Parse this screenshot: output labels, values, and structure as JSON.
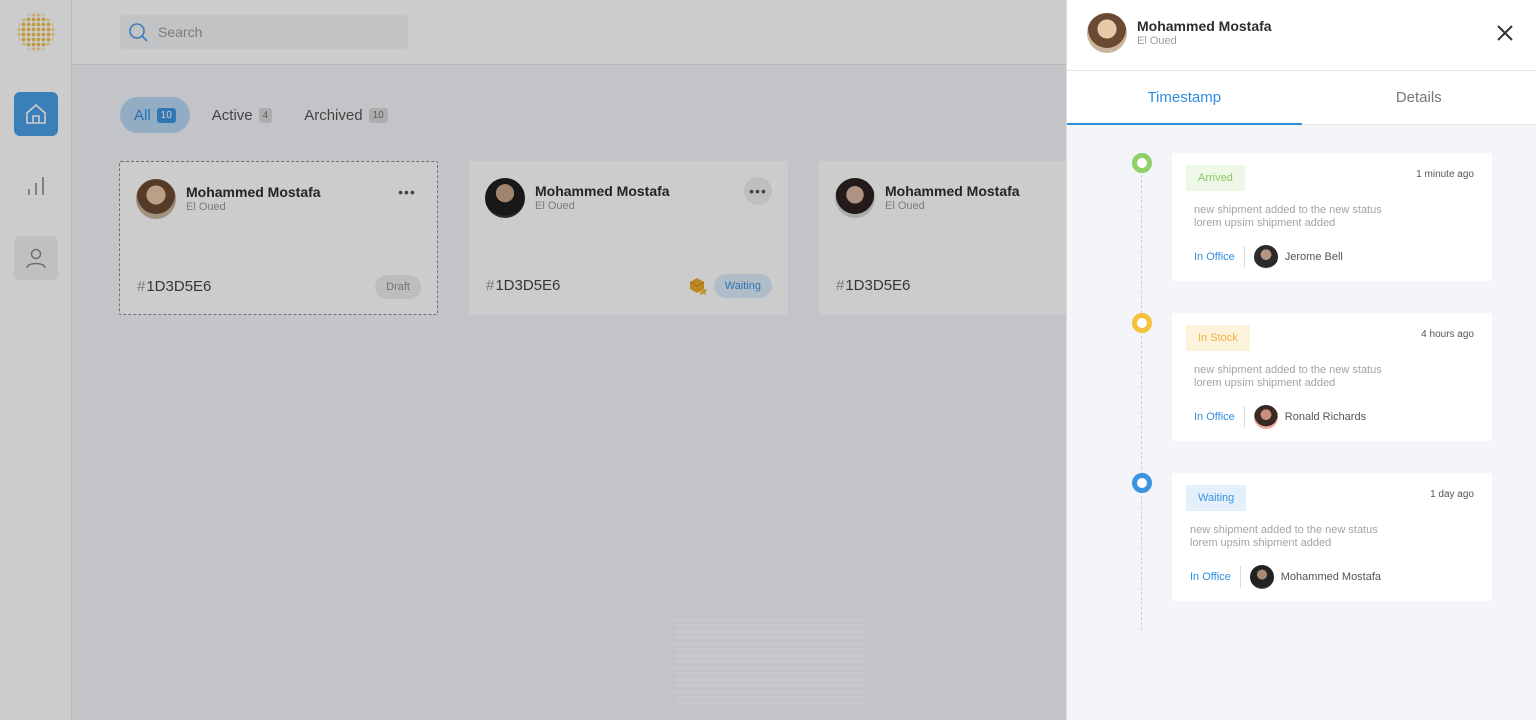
{
  "search": {
    "placeholder": "Search"
  },
  "filters": [
    {
      "label": "All",
      "count": "10"
    },
    {
      "label": "Active",
      "count": "4"
    },
    {
      "label": "Archived",
      "count": "10"
    }
  ],
  "cards": [
    {
      "name": "Mohammed Mostafa",
      "location": "El Oued",
      "code": "1D3D5E6",
      "status": "Draft"
    },
    {
      "name": "Mohammed Mostafa",
      "location": "El Oued",
      "code": "1D3D5E6",
      "status": "Waiting",
      "status_icon": "package-star-icon"
    },
    {
      "name": "Mohammed Mostafa",
      "location": "El Oued",
      "code": "1D3D5E6",
      "status": ""
    }
  ],
  "panel": {
    "name": "Mohammed Mostafa",
    "location": "El Oued",
    "tabs": [
      "Timestamp",
      "Details"
    ],
    "events": [
      {
        "status": "Arrived",
        "time": "1 minute ago",
        "desc1": "new shipment added to the new status",
        "desc2": "lorem upsim shipment added",
        "office": "In Office",
        "person": "Jerome Bell",
        "color": "#8fd06a"
      },
      {
        "status": "In Stock",
        "time": "4 hours ago",
        "desc1": "new shipment added to the new status",
        "desc2": "lorem upsim shipment added",
        "office": "In Office",
        "person": "Ronald Richards",
        "color": "#f6c23a"
      },
      {
        "status": "Waiting",
        "time": "1 day ago",
        "desc1": "new shipment added to the new status",
        "desc2": "lorem upsim shipment added",
        "office": "In Office",
        "person": "Mohammed Mostafa",
        "color": "#3d95e2"
      }
    ]
  },
  "colors": {
    "accent": "#3d95e2",
    "arrived": "#8fd06a",
    "stock": "#f6c23a"
  },
  "icons": [
    "search-icon",
    "home-icon",
    "chart-icon",
    "user-icon",
    "close-icon",
    "more-icon"
  ]
}
